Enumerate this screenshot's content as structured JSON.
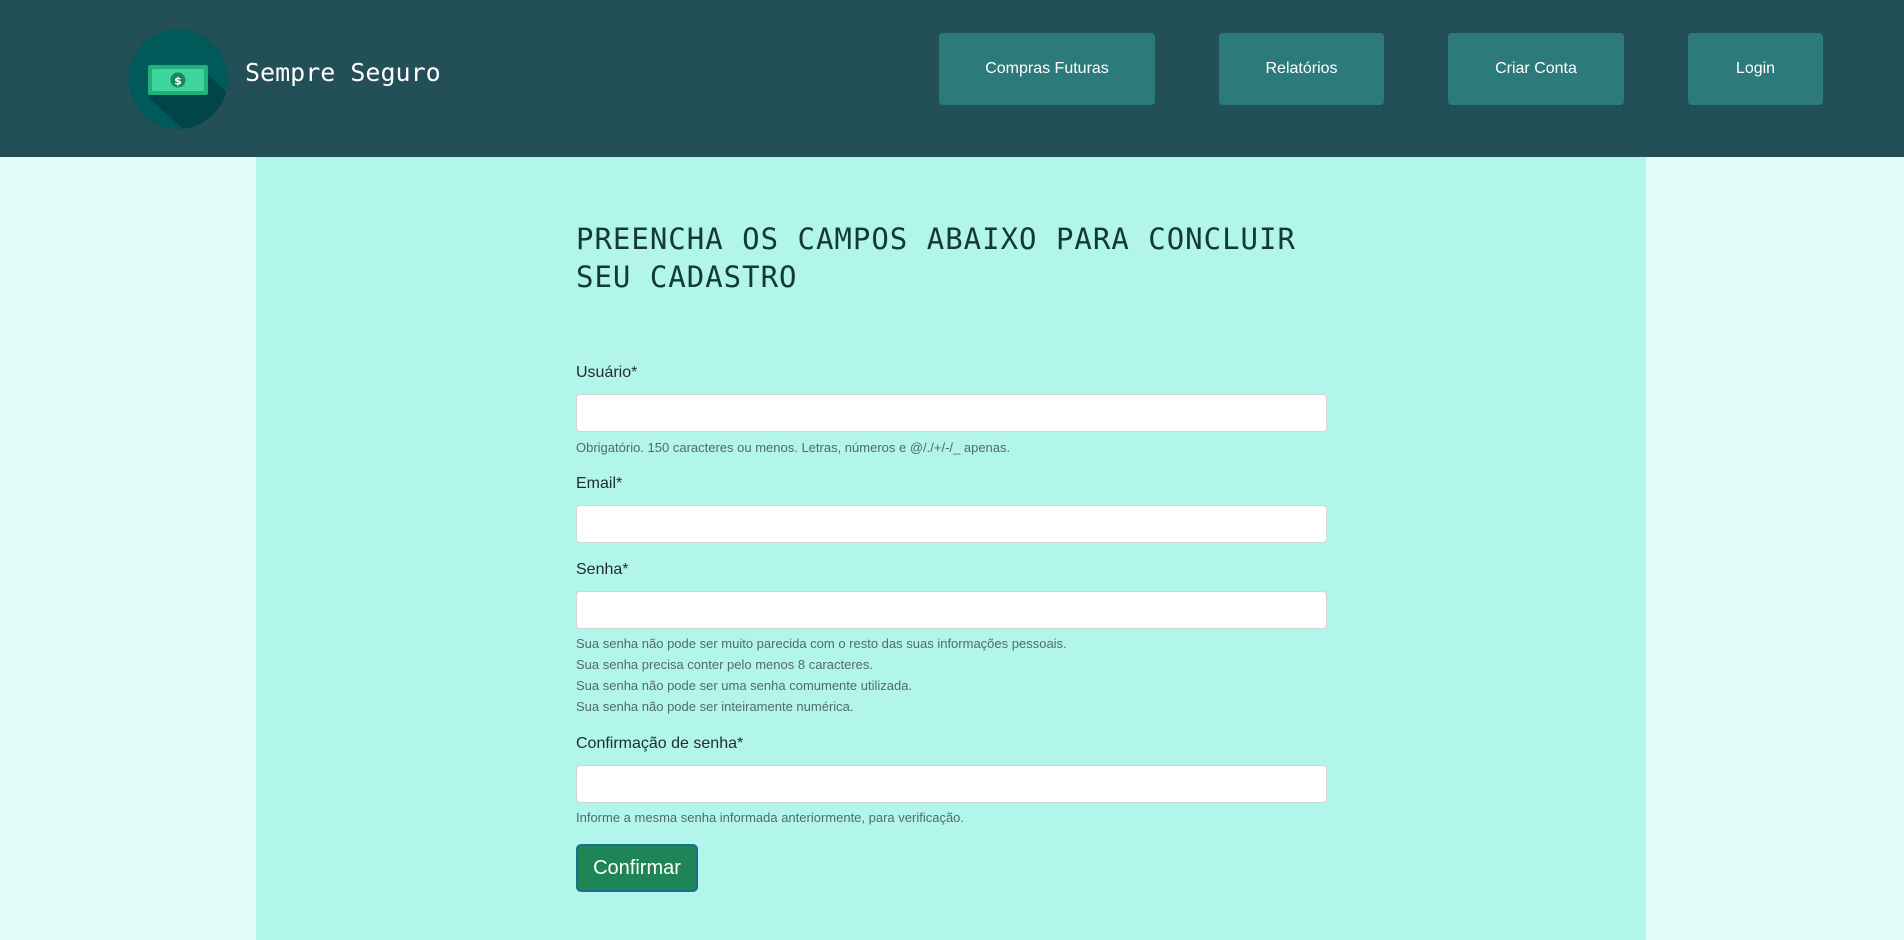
{
  "header": {
    "logo_icon": "money-bill-icon",
    "brand": "Sempre Seguro",
    "nav": [
      {
        "label": "Compras Futuras"
      },
      {
        "label": "Relatórios"
      },
      {
        "label": "Criar Conta"
      },
      {
        "label": "Login"
      }
    ]
  },
  "form": {
    "title_line1": "PREENCHA OS CAMPOS ABAIXO PARA CONCLUIR",
    "title_line2": "SEU CADASTRO",
    "username": {
      "label": "Usuário*",
      "value": "",
      "help": "Obrigatório. 150 caracteres ou menos. Letras, números e @/./+/-/_ apenas."
    },
    "email": {
      "label": "Email*",
      "value": ""
    },
    "password": {
      "label": "Senha*",
      "value": "",
      "help": [
        "Sua senha não pode ser muito parecida com o resto das suas informações pessoais.",
        "Sua senha precisa conter pelo menos 8 caracteres.",
        "Sua senha não pode ser uma senha comumente utilizada.",
        "Sua senha não pode ser inteiramente numérica."
      ]
    },
    "password_confirm": {
      "label": "Confirmação de senha*",
      "value": "",
      "help": "Informe a mesma senha informada anteriormente, para verificação."
    },
    "submit_label": "Confirmar"
  },
  "colors": {
    "header_bg": "#234f56",
    "nav_button_bg": "#2c7a7b",
    "page_bg": "#e0fdf8",
    "content_bg": "#b2f5ea",
    "submit_bg": "#1e8656"
  }
}
